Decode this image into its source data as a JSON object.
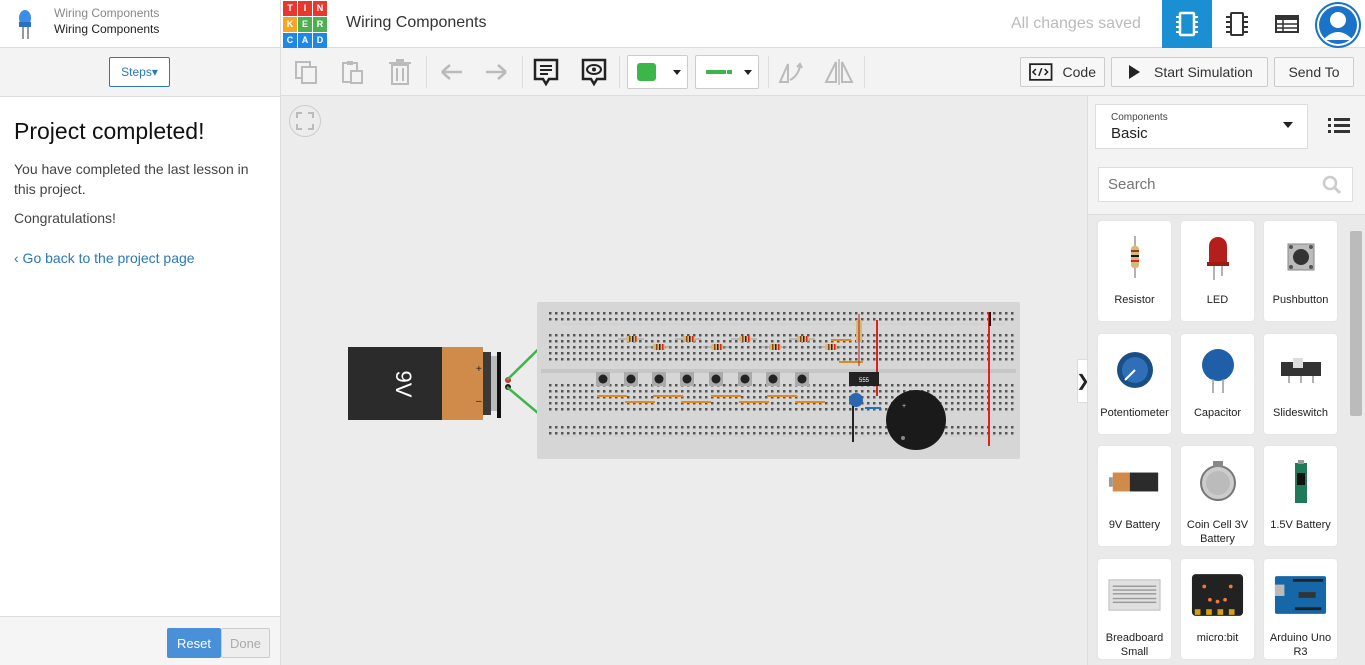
{
  "lesson": {
    "project_name": "Wiring Components",
    "lesson_name": "Wiring Components"
  },
  "logo": {
    "letters": [
      "T",
      "I",
      "N",
      "K",
      "E",
      "R",
      "C",
      "A",
      "D"
    ]
  },
  "header": {
    "title": "Wiring Components",
    "status": "All changes saved"
  },
  "sidebar": {
    "steps_label": "Steps▾",
    "title": "Project completed!",
    "body": "You have completed the last lesson in this project.",
    "congrats": "Congratulations!",
    "back_link": "‹ Go back to the project page",
    "reset_label": "Reset",
    "done_label": "Done"
  },
  "toolbar": {
    "code_label": "Code",
    "start_sim_label": "Start Simulation",
    "send_to_label": "Send To",
    "color_swatch": "#3cb54a",
    "wire_color": "#3cb54a"
  },
  "components": {
    "selector_label": "Components",
    "selector_value": "Basic",
    "search_placeholder": "Search",
    "items": [
      {
        "name": "Resistor",
        "icon": "resistor-icon"
      },
      {
        "name": "LED",
        "icon": "led-icon"
      },
      {
        "name": "Pushbutton",
        "icon": "pushbutton-icon"
      },
      {
        "name": "Potentiometer",
        "icon": "potentiometer-icon"
      },
      {
        "name": "Capacitor",
        "icon": "capacitor-icon"
      },
      {
        "name": "Slideswitch",
        "icon": "slideswitch-icon"
      },
      {
        "name": "9V Battery",
        "icon": "battery-9v-icon"
      },
      {
        "name": "Coin Cell 3V Battery",
        "icon": "coin-cell-icon"
      },
      {
        "name": "1.5V Battery",
        "icon": "battery-1-5v-icon"
      },
      {
        "name": "Breadboard Small",
        "icon": "breadboard-icon"
      },
      {
        "name": "micro:bit",
        "icon": "microbit-icon"
      },
      {
        "name": "Arduino Uno R3",
        "icon": "arduino-icon"
      }
    ]
  },
  "circuit": {
    "battery_label": "9V",
    "chip_label": "555"
  },
  "colors": {
    "accent": "#1a8fd1",
    "link": "#2a78b8",
    "reset": "#4a90d9"
  }
}
